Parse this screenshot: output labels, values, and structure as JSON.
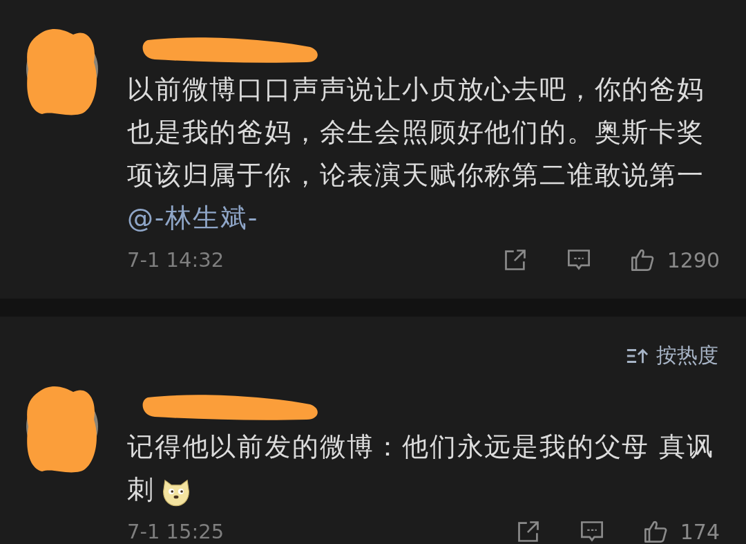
{
  "comments": [
    {
      "body": "以前微博口口声声说让小贞放心去吧，你的爸妈也是我的爸妈，余生会照顾好他们的。奥斯卡奖项该归属于你，论表演天赋你称第二谁敢说第一",
      "mention": "@-林生斌-",
      "emoji": false,
      "time": "7-1 14:32",
      "likes": "1290"
    },
    {
      "body": "记得他以前发的微博：他们永远是我的父母  真讽刺",
      "emoji": true,
      "time": "7-1 15:25",
      "likes": "174"
    }
  ],
  "sort": {
    "label": "按热度"
  }
}
